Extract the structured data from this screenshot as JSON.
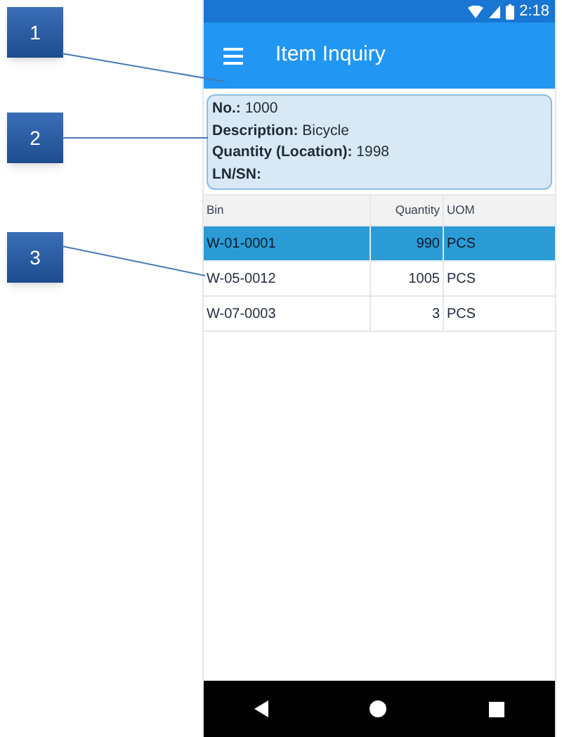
{
  "callouts": [
    "1",
    "2",
    "3"
  ],
  "status_bar": {
    "time": "2:18"
  },
  "app_bar": {
    "title": "Item Inquiry"
  },
  "info": [
    {
      "label": "No.:",
      "value": "1000"
    },
    {
      "label": "Description:",
      "value": "Bicycle"
    },
    {
      "label": "Quantity (Location):",
      "value": "1998"
    },
    {
      "label": "LN/SN:"
    }
  ],
  "table": {
    "columns": [
      "Bin",
      "Quantity",
      "UOM"
    ],
    "rows": [
      {
        "cells": [
          "W-01-0001",
          "990",
          "PCS"
        ],
        "selected": true
      },
      {
        "cells": [
          "W-05-0012",
          "1005",
          "PCS"
        ],
        "selected": false
      },
      {
        "cells": [
          "W-07-0003",
          "3",
          "PCS"
        ],
        "selected": false
      }
    ]
  }
}
